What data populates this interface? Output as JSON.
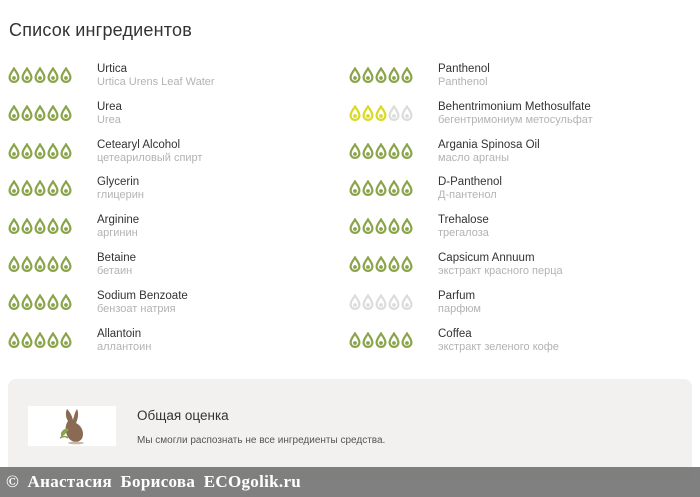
{
  "section_title": "Список ингредиентов",
  "icons": {
    "rating": "droplet-rating-icon",
    "mascot": "rabbit-icon"
  },
  "colors": {
    "safe": "#8aa44a",
    "moderate": "#d9d923",
    "unknown": "#dcdcdc"
  },
  "left_ingredients": [
    {
      "name": "Urtica",
      "sub": "Urtica Urens Leaf Water",
      "rating": 5,
      "level": "safe"
    },
    {
      "name": "Urea",
      "sub": "Urea",
      "rating": 5,
      "level": "safe"
    },
    {
      "name": "Cetearyl Alcohol",
      "sub": "цетеариловый спирт",
      "rating": 5,
      "level": "safe"
    },
    {
      "name": "Glycerin",
      "sub": "глицерин",
      "rating": 5,
      "level": "safe"
    },
    {
      "name": "Arginine",
      "sub": "аргинин",
      "rating": 5,
      "level": "safe"
    },
    {
      "name": "Betaine",
      "sub": "бетаин",
      "rating": 5,
      "level": "safe"
    },
    {
      "name": "Sodium Benzoate",
      "sub": "бензоат натрия",
      "rating": 5,
      "level": "safe"
    },
    {
      "name": "Allantoin",
      "sub": "аллантоин",
      "rating": 5,
      "level": "safe"
    }
  ],
  "right_ingredients": [
    {
      "name": "Panthenol",
      "sub": "Panthenol",
      "rating": 5,
      "level": "safe"
    },
    {
      "name": "Behentrimonium Methosulfate",
      "sub": "бегентримониум метосульфат",
      "rating": 3,
      "level": "moderate"
    },
    {
      "name": "Argania Spinosa Oil",
      "sub": "масло арганы",
      "rating": 5,
      "level": "safe"
    },
    {
      "name": "D-Panthenol",
      "sub": "Д-пантенол",
      "rating": 5,
      "level": "safe"
    },
    {
      "name": "Trehalose",
      "sub": "трегалоза",
      "rating": 5,
      "level": "safe"
    },
    {
      "name": "Capsicum Annuum",
      "sub": "экстракт красного перца",
      "rating": 5,
      "level": "safe"
    },
    {
      "name": "Parfum",
      "sub": "парфюм",
      "rating": 0,
      "level": "unknown"
    },
    {
      "name": "Coffea",
      "sub": "экстракт зеленого кофе",
      "rating": 5,
      "level": "safe"
    }
  ],
  "summary": {
    "title": "Общая оценка",
    "text": "Мы смогли распознать не все ингредиенты средства."
  },
  "watermark": "© Анастасия Борисова ECOgolik.ru"
}
